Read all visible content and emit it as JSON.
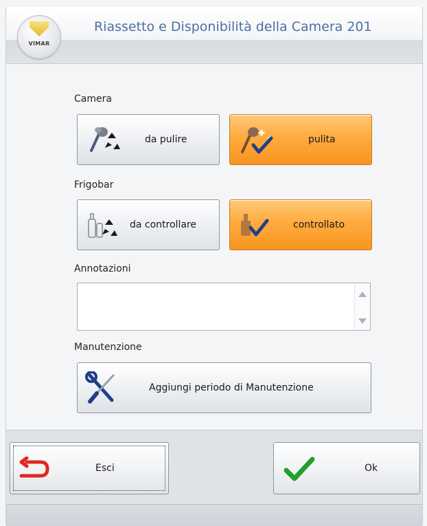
{
  "window": {
    "title": "Riassetto e Disponibilità della Camera 201",
    "logo_text": "VIMAR"
  },
  "camera": {
    "label": "Camera",
    "dirty_label": "da pulire",
    "clean_label": "pulita",
    "selected": "pulita"
  },
  "minibar": {
    "label": "Frigobar",
    "to_check_label": "da controllare",
    "checked_label": "controllato",
    "selected": "controllato"
  },
  "notes": {
    "label": "Annotazioni",
    "value": ""
  },
  "maintenance": {
    "label": "Manutenzione",
    "add_label": "Aggiungi periodo di Manutenzione"
  },
  "footer": {
    "exit_label": "Esci",
    "ok_label": "Ok"
  },
  "colors": {
    "accent_selected": "#ffab3f",
    "title_text": "#4d6fa3",
    "exit_icon": "#e0281f",
    "ok_icon": "#22a02a",
    "icon_blue": "#1f3f8a"
  }
}
